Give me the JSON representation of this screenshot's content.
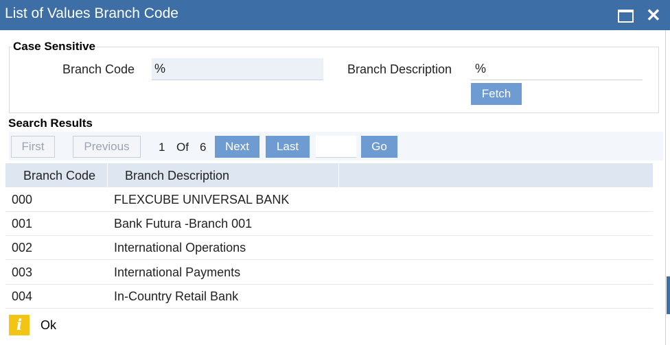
{
  "window": {
    "title": "List of Values Branch Code",
    "maximize_icon": "maximize-icon",
    "close_icon": "close-icon",
    "close_glyph": "✕"
  },
  "criteria": {
    "legend": "Case Sensitive",
    "branch_code_label": "Branch Code",
    "branch_code_value": "%",
    "branch_description_label": "Branch Description",
    "branch_description_value": "%",
    "fetch_label": "Fetch"
  },
  "results": {
    "title": "Search Results",
    "pager": {
      "first_label": "First",
      "previous_label": "Previous",
      "current_page": "1",
      "of_label": "Of",
      "total_pages": "6",
      "next_label": "Next",
      "last_label": "Last",
      "goto_value": "",
      "go_label": "Go"
    },
    "columns": [
      "Branch Code",
      "Branch Description"
    ],
    "rows": [
      {
        "code": "000",
        "description": "FLEXCUBE UNIVERSAL BANK"
      },
      {
        "code": "001",
        "description": "Bank Futura -Branch 001"
      },
      {
        "code": "002",
        "description": "International Operations"
      },
      {
        "code": "003",
        "description": "International Payments"
      },
      {
        "code": "004",
        "description": "In-Country Retail Bank"
      }
    ]
  },
  "footer": {
    "info_icon": "info-icon",
    "info_glyph": "i",
    "ok_label": "Ok"
  },
  "colors": {
    "titlebar": "#3d6ea6",
    "button": "#6e9cd2",
    "header_row": "#dde6f1",
    "info_icon": "#f2c515"
  }
}
